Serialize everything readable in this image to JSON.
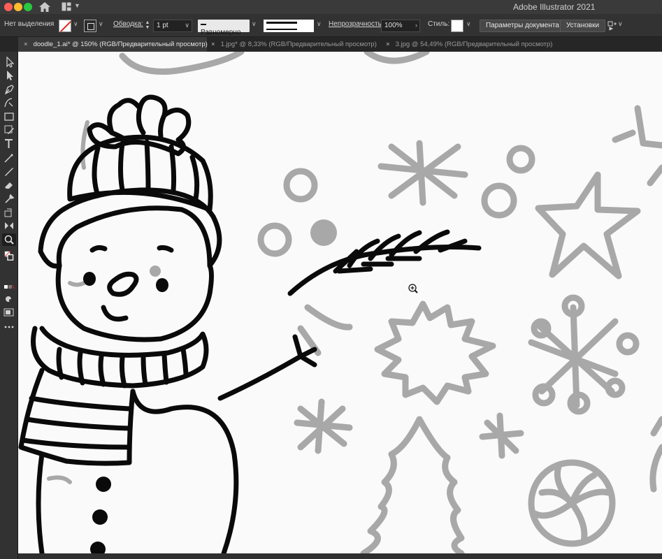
{
  "app": {
    "title": "Adobe Illustrator 2021"
  },
  "control_bar": {
    "selection_label": "Нет выделения",
    "stroke_label": "Обводка:",
    "stroke_weight": "1 pt",
    "profile_label": "Равномерно",
    "opacity_label": "Непрозрачность:",
    "opacity_value": "100%",
    "style_label": "Стиль:",
    "doc_setup_button": "Параметры документа",
    "prefs_button": "Установки"
  },
  "tabs": [
    {
      "label": "doodle_1.ai* @ 150% (RGB/Предварительный просмотр)",
      "active": true
    },
    {
      "label": "1.jpg* @ 8,33% (RGB/Предварительный просмотр)",
      "active": false
    },
    {
      "label": "3.jpg @ 54,49% (RGB/Предварительный просмотр)",
      "active": false
    }
  ],
  "tools": [
    "selection-tool",
    "direct-selection-tool",
    "pen-tool",
    "curvature-tool",
    "rectangle-tool",
    "pencil-tool",
    "type-tool",
    "line-segment-tool",
    "paintbrush-tool",
    "eraser-tool",
    "eyedropper-tool",
    "rotate-tool",
    "scale-tool",
    "width-tool",
    "zoom-tool",
    "hand-tool",
    "fill-stroke-swatches",
    "draw-mode",
    "screen-mode",
    "edit-toolbar"
  ],
  "colors": {
    "chrome": "#323232",
    "canvas": "#fafafa",
    "ink": "#0a0a0a",
    "template_gray": "#a8a8a8",
    "accent_red": "#e1251b"
  }
}
